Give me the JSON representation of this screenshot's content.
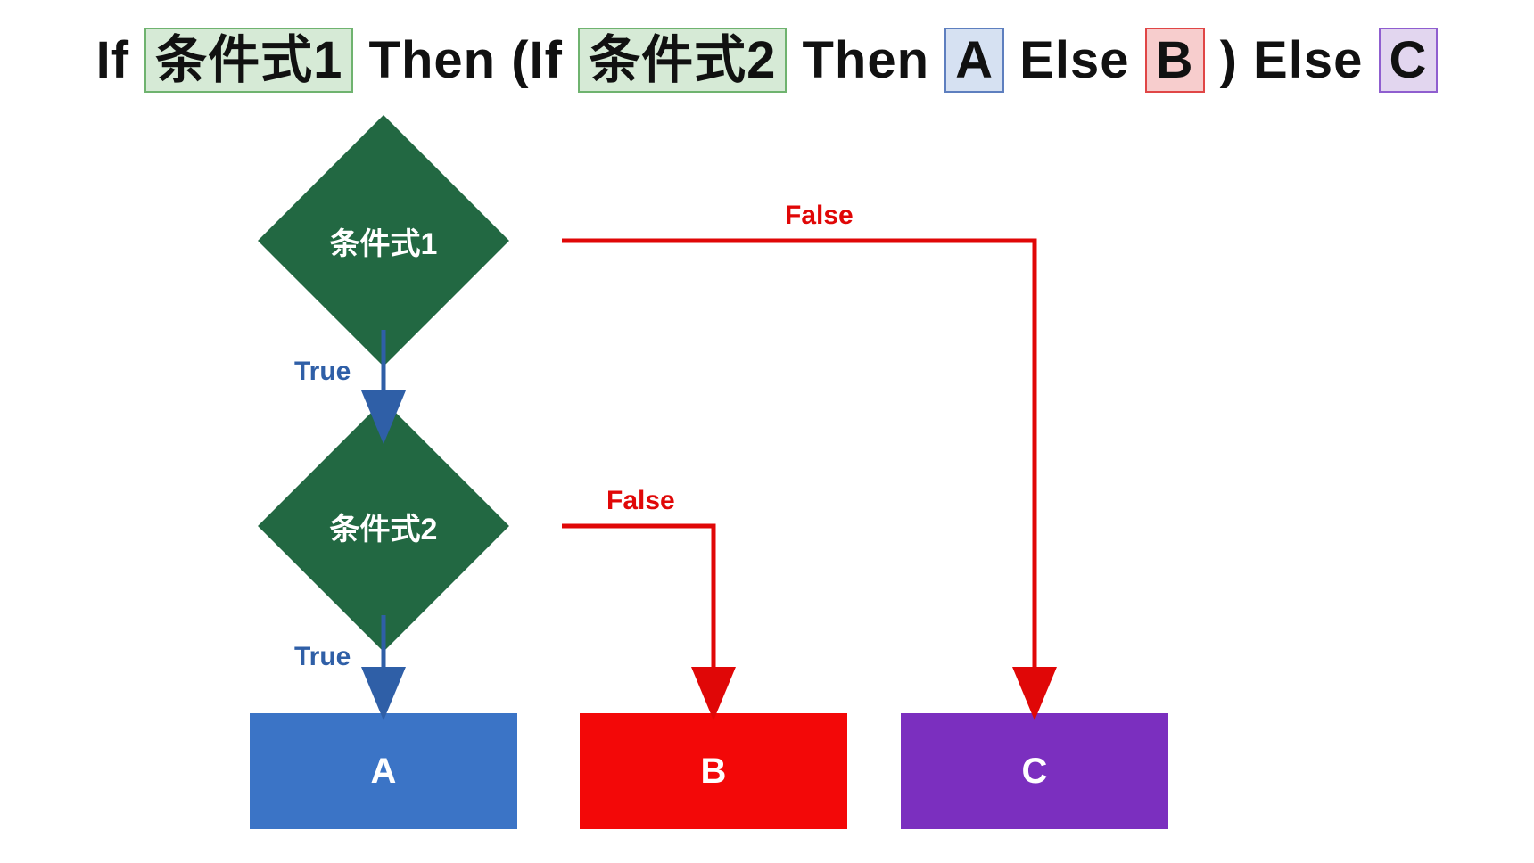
{
  "title": {
    "t_if1": "If",
    "cond1": "条件式1",
    "t_then1": "Then (If",
    "cond2": "条件式2",
    "t_then2": "Then",
    "a": "A",
    "t_else2": "Else",
    "b": "B",
    "t_close": ")  Else",
    "c": "C"
  },
  "diamonds": {
    "d1": "条件式1",
    "d2": "条件式2"
  },
  "boxes": {
    "a": "A",
    "b": "B",
    "c": "C"
  },
  "edge_labels": {
    "d1_true": "True",
    "d1_false": "False",
    "d2_true": "True",
    "d2_false": "False"
  },
  "colors": {
    "diamond_fill": "#226842",
    "box_a": "#3b74c6",
    "box_b": "#f30808",
    "box_c": "#7b2fbf",
    "arrow_true": "#2f5fa7",
    "arrow_false": "#e00707",
    "hl_green_bg": "#d6ead6",
    "hl_blue_bg": "#d6e1f2",
    "hl_red_bg": "#f7cdcd",
    "hl_purple_bg": "#e2d6ef"
  },
  "diagram_semantics": {
    "structure": "If 条件式1 Then (If 条件式2 Then A Else B) Else C",
    "node_cond1": {
      "type": "decision",
      "label": "条件式1",
      "true_to": "node_cond2",
      "false_to": "box_C"
    },
    "node_cond2": {
      "type": "decision",
      "label": "条件式2",
      "true_to": "box_A",
      "false_to": "box_B"
    },
    "box_A": {
      "type": "process",
      "label": "A"
    },
    "box_B": {
      "type": "process",
      "label": "B"
    },
    "box_C": {
      "type": "process",
      "label": "C"
    }
  }
}
